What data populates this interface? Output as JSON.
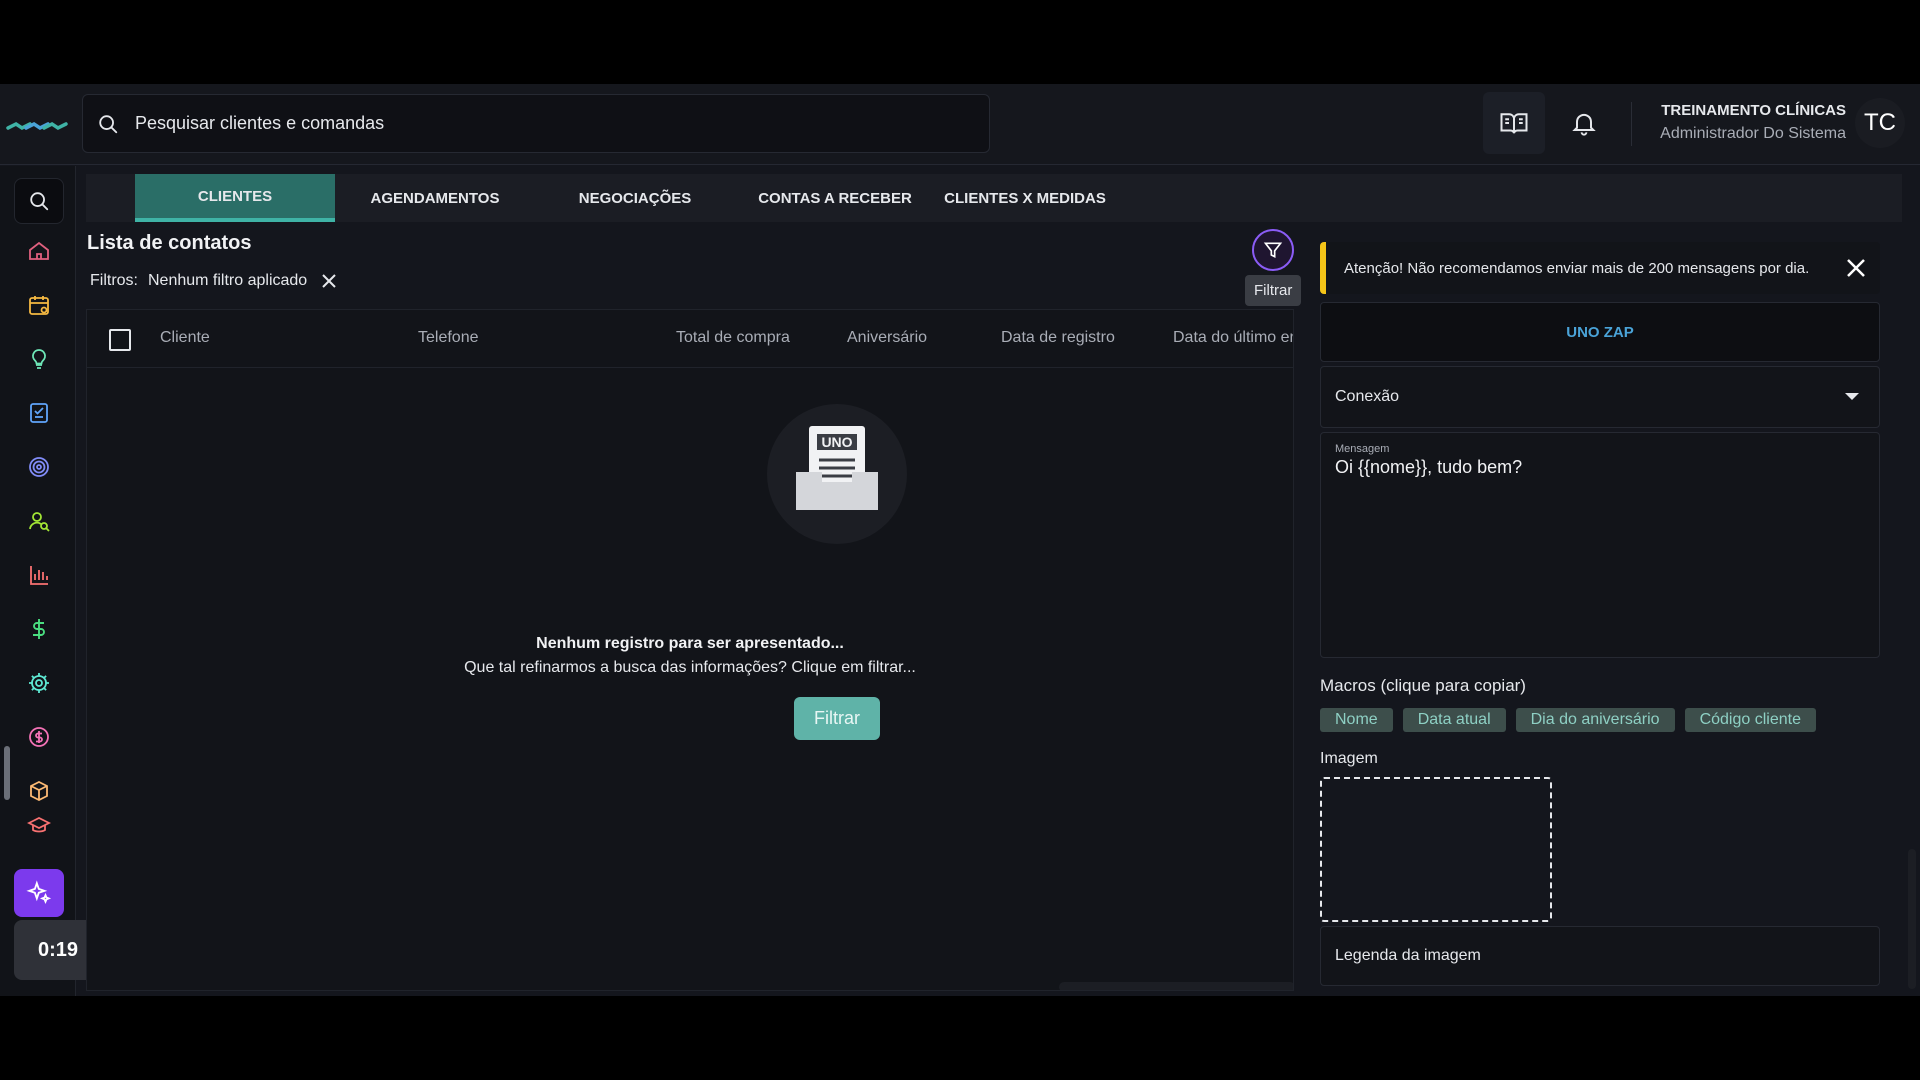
{
  "header": {
    "search_placeholder": "Pesquisar clientes e comandas",
    "user_name": "TREINAMENTO CLÍNICAS",
    "user_role": "Administrador Do Sistema",
    "avatar_initials": "TC"
  },
  "tabs": [
    {
      "label": "CLIENTES",
      "active": true
    },
    {
      "label": "AGENDAMENTOS"
    },
    {
      "label": "NEGOCIAÇÕES"
    },
    {
      "label": "CONTAS A RECEBER"
    },
    {
      "label": "CLIENTES X MEDIDAS"
    }
  ],
  "contacts": {
    "title": "Lista de contatos",
    "filters_label": "Filtros:",
    "filters_value": "Nenhum filtro aplicado",
    "filter_tooltip": "Filtrar",
    "columns": [
      "Cliente",
      "Telefone",
      "Total de compra",
      "Aniversário",
      "Data de registro",
      "Data do último en"
    ],
    "empty_logo_text": "UNO",
    "empty_title": "Nenhum registro para ser apresentado...",
    "empty_subtitle": "Que tal refinarmos a busca das informações? Clique em filtrar...",
    "empty_button": "Filtrar"
  },
  "panel": {
    "alert_text": "Atenção! Não recomendamos enviar mais de 200 mensagens por dia.",
    "unozap_label": "UNO ZAP",
    "connection_label": "Conexão",
    "message_label": "Mensagem",
    "message_value": "Oi {{nome}}, tudo bem?",
    "macros_title": "Macros (clique para copiar)",
    "macros": [
      "Nome",
      "Data atual",
      "Dia do aniversário",
      "Código cliente"
    ],
    "image_title": "Imagem",
    "caption_placeholder": "Legenda da imagem"
  },
  "recorder": {
    "time": "0:19"
  },
  "colors": {
    "accent_teal": "#3fb3a6",
    "ai_purple": "#7c3aed",
    "alert_yellow": "#f5c518",
    "unozap_blue": "#4aa3d8"
  }
}
